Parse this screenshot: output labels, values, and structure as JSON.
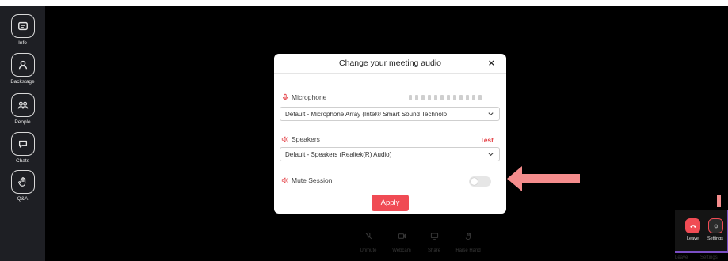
{
  "sidebar": {
    "items": [
      {
        "label": "Info",
        "icon": "info-card-icon"
      },
      {
        "label": "Backstage",
        "icon": "person-icon"
      },
      {
        "label": "People",
        "icon": "people-icon"
      },
      {
        "label": "Chats",
        "icon": "chat-icon"
      },
      {
        "label": "Q&A",
        "icon": "raise-hand-icon"
      }
    ]
  },
  "modal": {
    "title": "Change your meeting audio",
    "close_label": "×",
    "microphone": {
      "label": "Microphone",
      "selected": "Default - Microphone Array (Intel® Smart Sound Technolo"
    },
    "speakers": {
      "label": "Speakers",
      "test_label": "Test",
      "selected": "Default - Speakers (Realtek(R) Audio)"
    },
    "mute_session": {
      "label": "Mute Session",
      "enabled": false
    },
    "apply_label": "Apply"
  },
  "bottom_toolbar": {
    "items": [
      {
        "label": "Unmute",
        "icon": "mic-off-icon"
      },
      {
        "label": "Webcam",
        "icon": "camera-icon"
      },
      {
        "label": "Share",
        "icon": "screen-share-icon"
      },
      {
        "label": "Raise Hand",
        "icon": "raise-hand-icon"
      }
    ]
  },
  "background_labels": {
    "leave": "Leave",
    "settings": "Settings"
  },
  "popup": {
    "leave_label": "Leave",
    "settings_label": "Settings"
  },
  "colors": {
    "accent": "#f04b54",
    "arrow": "#f48c8c",
    "sidebar_bg": "#1e1f24",
    "popup_border": "#7a4ec4"
  }
}
